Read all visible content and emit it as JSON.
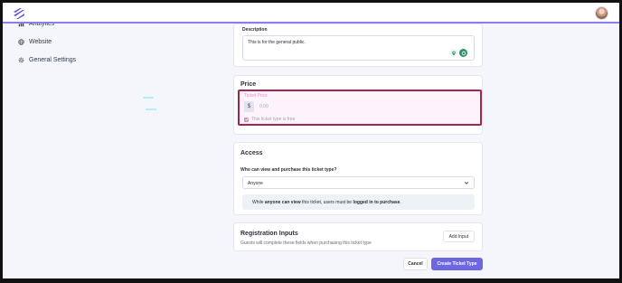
{
  "sidebar": {
    "items": [
      {
        "label": "Analytics",
        "icon": "bar-chart-icon"
      },
      {
        "label": "Website",
        "icon": "globe-icon"
      },
      {
        "label": "General Settings",
        "icon": "gear-icon"
      }
    ]
  },
  "description": {
    "label": "Description",
    "value": "This is for the general public."
  },
  "price": {
    "title": "Price",
    "field_label": "Ticket Price",
    "currency_symbol": "$",
    "placeholder": "0.00",
    "free_label": "This ticket type is free",
    "free_checked": true
  },
  "access": {
    "title": "Access",
    "question": "Who can view and purchase this ticket type?",
    "selected": "Anyone",
    "notice_prefix": "While ",
    "notice_bold1": "anyone can view",
    "notice_mid": " this ticket, users must be ",
    "notice_bold2": "logged in to purchase",
    "notice_suffix": "."
  },
  "registration": {
    "title": "Registration Inputs",
    "subtitle": "Guests will complete these fields when purchasing this ticket type",
    "add_button": "Add Input"
  },
  "actions": {
    "cancel": "Cancel",
    "create": "Create Ticket Type"
  },
  "colors": {
    "accent": "#6f66e6",
    "highlight_border": "#a3244e",
    "topbar_line": "#8a7cf2"
  }
}
